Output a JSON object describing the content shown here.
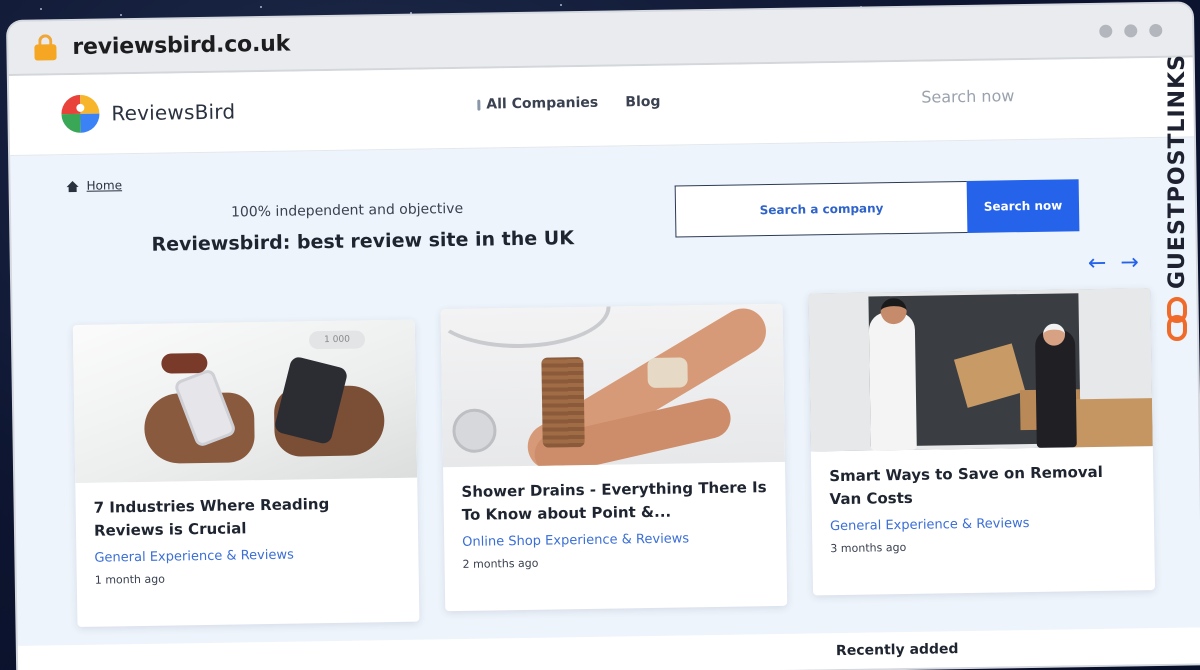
{
  "browser": {
    "url": "reviewsbird.co.uk"
  },
  "nav": {
    "brand": "ReviewsBird",
    "links": [
      "All Companies",
      "Blog"
    ],
    "search_label": "Search now"
  },
  "hero": {
    "breadcrumb_home": "Home",
    "tagline": "100% independent and objective",
    "headline": "Reviewsbird: best review site in the UK",
    "search_placeholder": "Search a company",
    "search_button": "Search now",
    "prev_arrow": "←",
    "next_arrow": "→"
  },
  "cards": [
    {
      "title": "7 Industries Where Reading Reviews is Crucial",
      "category": "General Experience & Reviews",
      "date": "1 month ago",
      "image_badge": "1 000"
    },
    {
      "title": "Shower Drains - Everything There Is To Know about Point &...",
      "category": "Online Shop Experience & Reviews",
      "date": "2 months ago"
    },
    {
      "title": "Smart Ways to Save on Removal Van Costs",
      "category": "General Experience & Reviews",
      "date": "3 months ago"
    }
  ],
  "section": {
    "recently_added": "Recently added"
  },
  "watermark": {
    "text": "GUESTPOSTLINKS"
  },
  "colors": {
    "accent": "#2563eb",
    "category_link": "#3b6fd6",
    "lock": "#f5a623",
    "watermark_icon": "#f06a2a"
  }
}
